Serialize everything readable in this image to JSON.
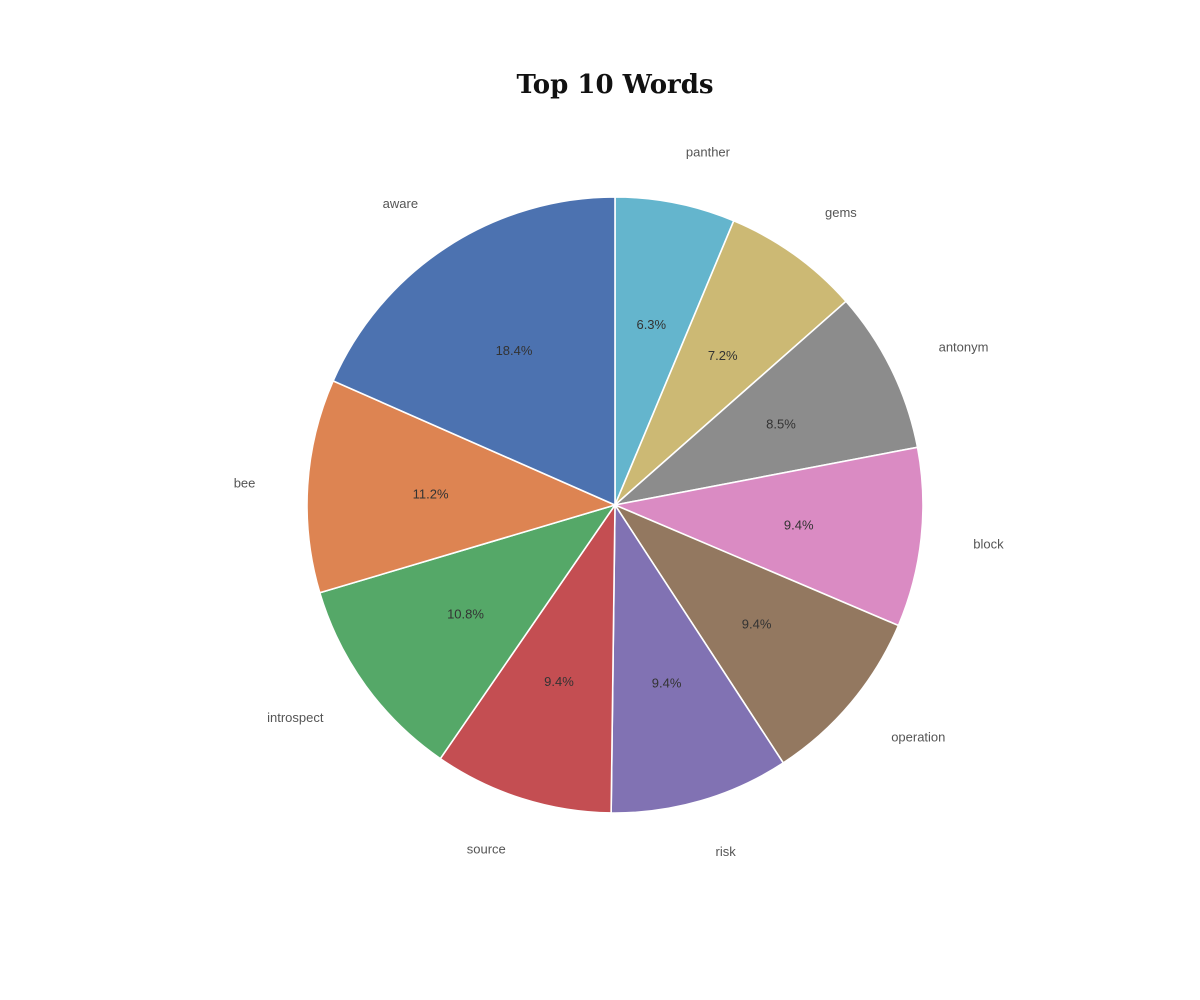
{
  "chart_data": {
    "type": "pie",
    "title": "Top 10 Words",
    "start": "12 o'clock",
    "direction": "clockwise",
    "slices": [
      {
        "label": "panther",
        "value": 6.3,
        "pct_label": "6.3%",
        "color": "#64b5cd"
      },
      {
        "label": "gems",
        "value": 7.2,
        "pct_label": "7.2%",
        "color": "#ccb974"
      },
      {
        "label": "antonym",
        "value": 8.5,
        "pct_label": "8.5%",
        "color": "#8c8c8c"
      },
      {
        "label": "block",
        "value": 9.4,
        "pct_label": "9.4%",
        "color": "#da8bc3"
      },
      {
        "label": "operation",
        "value": 9.4,
        "pct_label": "9.4%",
        "color": "#937860"
      },
      {
        "label": "risk",
        "value": 9.4,
        "pct_label": "9.4%",
        "color": "#8172b3"
      },
      {
        "label": "source",
        "value": 9.4,
        "pct_label": "9.4%",
        "color": "#c44e52"
      },
      {
        "label": "introspect",
        "value": 10.8,
        "pct_label": "10.8%",
        "color": "#55a868"
      },
      {
        "label": "bee",
        "value": 11.2,
        "pct_label": "11.2%",
        "color": "#dd8452"
      },
      {
        "label": "aware",
        "value": 18.4,
        "pct_label": "18.4%",
        "color": "#4c72b0"
      }
    ]
  }
}
